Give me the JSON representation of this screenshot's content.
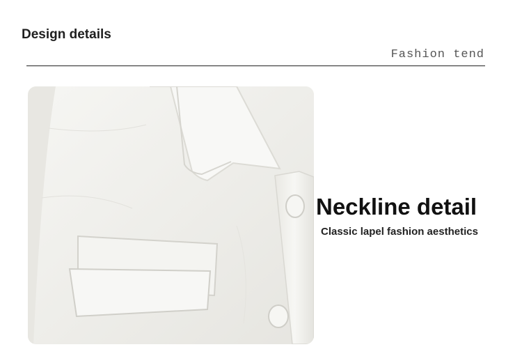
{
  "header": {
    "title": "Design details",
    "subtitle": "Fashion tend"
  },
  "photo": {
    "subject": "white shirt close-up with lapel collar, chest flap pocket and buttons",
    "base_color": "#f1f0ec"
  },
  "detail": {
    "heading": "Neckline detail",
    "caption": "Classic lapel fashion aesthetics"
  }
}
